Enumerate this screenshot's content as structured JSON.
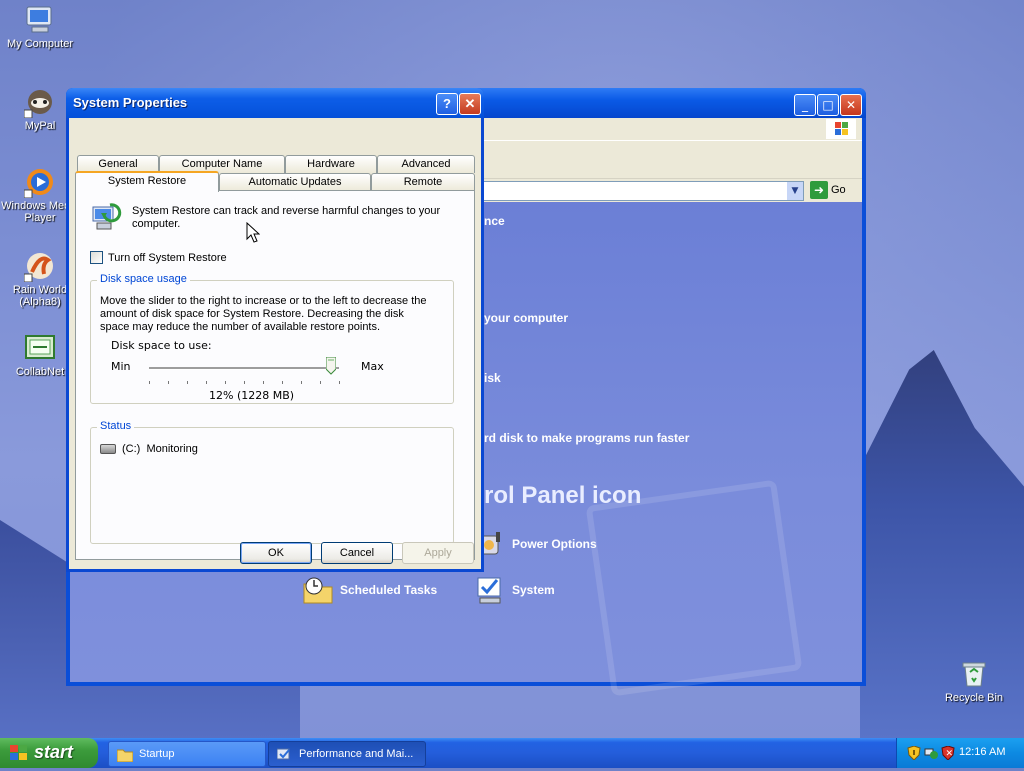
{
  "desktop": {
    "icons": [
      {
        "label": "My Computer",
        "icon": "my-computer-icon"
      },
      {
        "label": "MyPal",
        "icon": "mypal-icon"
      },
      {
        "label": "Windows Media Player",
        "icon": "media-player-icon"
      },
      {
        "label": "Rain World (Alpha8)",
        "icon": "rain-world-icon"
      },
      {
        "label": "CollabNet",
        "icon": "collabnet-icon"
      },
      {
        "label": "Recycle Bin",
        "icon": "recycle-bin-icon"
      }
    ]
  },
  "control_panel": {
    "go_label": "Go",
    "tasks": [
      "nce",
      "your computer",
      "isk",
      "rd disk to make programs run faster"
    ],
    "heading": "rol Panel icon",
    "items": [
      {
        "label": "Power Options",
        "icon": "power-options-icon"
      },
      {
        "label": "Scheduled Tasks",
        "icon": "scheduled-tasks-icon"
      },
      {
        "label": "System",
        "icon": "system-icon"
      }
    ]
  },
  "dialog": {
    "title": "System Properties",
    "help_label": "?",
    "close_label": "✕",
    "tabs_row1": [
      "General",
      "Computer Name",
      "Hardware",
      "Advanced"
    ],
    "tabs_row2": [
      "System Restore",
      "Automatic Updates",
      "Remote"
    ],
    "active_tab": "System Restore",
    "description": "System Restore can track and reverse harmful changes to your computer.",
    "turn_off_label": "Turn off System Restore",
    "turn_off_checked": false,
    "disk_group": {
      "title": "Disk space usage",
      "text": "Move the slider to the right to increase or to the left to decrease the amount of disk space for System Restore. Decreasing the disk space may reduce the number of available restore points.",
      "slider_label": "Disk space to use:",
      "min_label": "Min",
      "max_label": "Max",
      "slider_fraction": 0.96,
      "value_text": "12% (1228 MB)"
    },
    "status_group": {
      "title": "Status",
      "drive": "(C:)",
      "state": "Monitoring"
    },
    "buttons": {
      "ok": "OK",
      "cancel": "Cancel",
      "apply": "Apply"
    }
  },
  "taskbar": {
    "start_label": "start",
    "tasks": [
      {
        "label": "Startup",
        "icon": "folder-icon",
        "active": false
      },
      {
        "label": "Performance and Mai...",
        "icon": "control-panel-icon",
        "active": true
      }
    ],
    "clock": "12:16 AM"
  }
}
